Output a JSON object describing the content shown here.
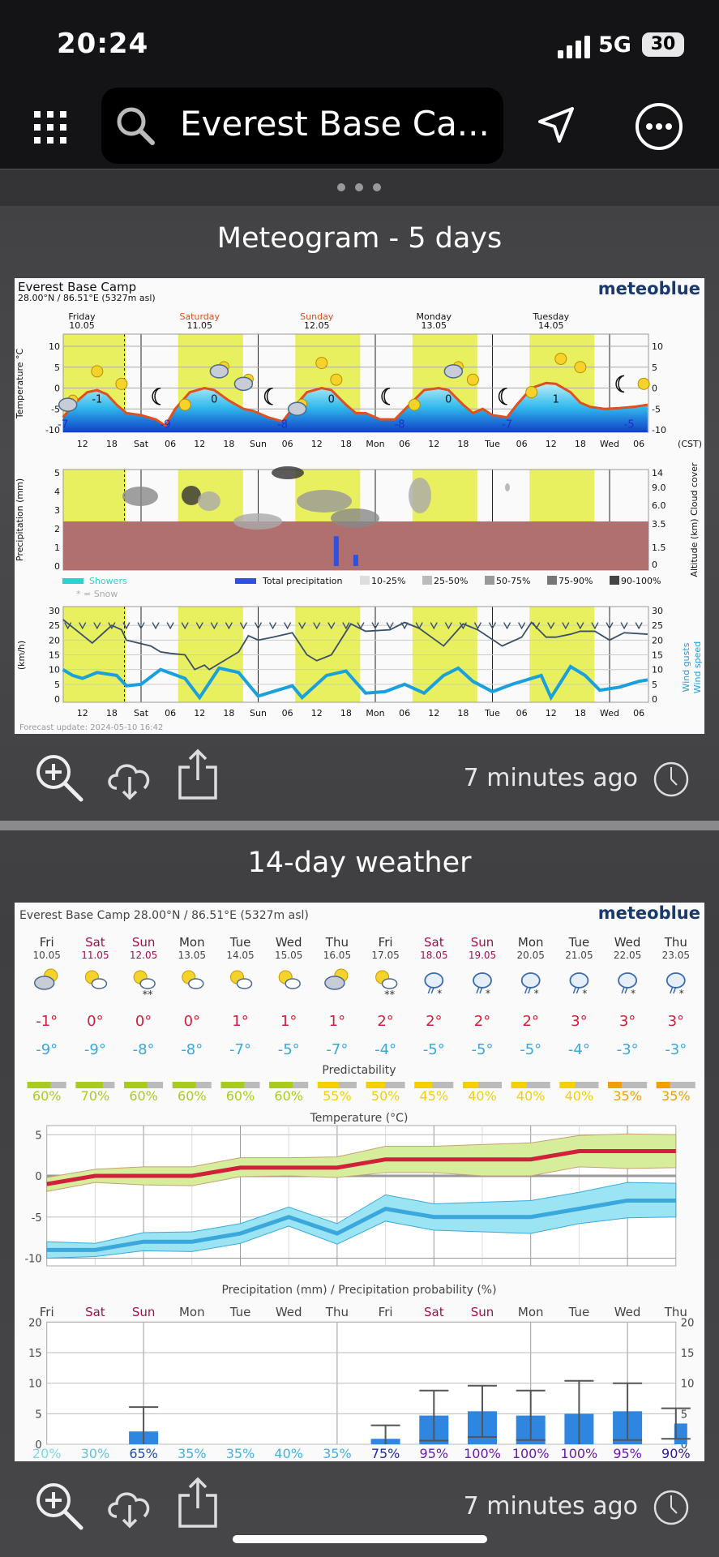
{
  "status_bar": {
    "time": "20:24",
    "network": "5G",
    "battery": "30"
  },
  "search": {
    "value": "Everest Base Ca..."
  },
  "icons": {
    "menu": "grid-icon",
    "search": "search-icon",
    "location": "location-arrow-icon",
    "more": "more-icon"
  },
  "meteogram": {
    "section_title": "Meteogram - 5 days",
    "location": "Everest Base Camp",
    "coords": "28.00°N / 86.51°E (5327m asl)",
    "brand": "meteoblue",
    "brand_color": "#1a3a6b",
    "days": [
      {
        "name": "Friday",
        "date": "10.05",
        "weekend": false
      },
      {
        "name": "Saturday",
        "date": "11.05",
        "weekend": true
      },
      {
        "name": "Sunday",
        "date": "12.05",
        "weekend": true
      },
      {
        "name": "Monday",
        "date": "13.05",
        "weekend": false
      },
      {
        "name": "Tuesday",
        "date": "14.05",
        "weekend": false
      }
    ],
    "x_ticks": [
      "12",
      "18",
      "Sat",
      "06",
      "12",
      "18",
      "Sun",
      "06",
      "12",
      "18",
      "Mon",
      "06",
      "12",
      "18",
      "Tue",
      "06",
      "12",
      "18",
      "Wed",
      "06"
    ],
    "timezone": "(CST)",
    "temp_axis_label": "Temperature °C",
    "temp_ticks": [
      10,
      5,
      0,
      -5,
      -10
    ],
    "temperature": [
      [
        8,
        -7
      ],
      [
        11,
        -3
      ],
      [
        13,
        -1
      ],
      [
        15,
        -0.5
      ],
      [
        17,
        -1.5
      ],
      [
        19,
        -4
      ],
      [
        21,
        -6
      ],
      [
        24,
        -6.5
      ],
      [
        27,
        -7.5
      ],
      [
        29,
        -9
      ],
      [
        31,
        -5
      ],
      [
        34,
        -1
      ],
      [
        37,
        0
      ],
      [
        39,
        -0.5
      ],
      [
        42,
        -3
      ],
      [
        45,
        -5
      ],
      [
        47,
        -5.5
      ],
      [
        50,
        -7
      ],
      [
        53,
        -8
      ],
      [
        55,
        -5
      ],
      [
        58,
        -1
      ],
      [
        61,
        0
      ],
      [
        63,
        -0.5
      ],
      [
        66,
        -4
      ],
      [
        68,
        -6
      ],
      [
        70,
        -6
      ],
      [
        73,
        -7.5
      ],
      [
        76,
        -7.5
      ],
      [
        79,
        -4
      ],
      [
        82,
        -0.5
      ],
      [
        85,
        0
      ],
      [
        87,
        -0.5
      ],
      [
        90,
        -4
      ],
      [
        92,
        -6
      ],
      [
        94,
        -5
      ],
      [
        96,
        -6.5
      ],
      [
        99,
        -7
      ],
      [
        101,
        -4
      ],
      [
        104,
        0
      ],
      [
        107,
        1.2
      ],
      [
        109,
        1
      ],
      [
        112,
        -1
      ],
      [
        114,
        -3.5
      ],
      [
        116,
        -4.5
      ],
      [
        119,
        -5
      ],
      [
        122,
        -4.8
      ],
      [
        125,
        -4.5
      ],
      [
        127.8,
        -4
      ]
    ],
    "max_labels": [
      "-1",
      "0",
      "0",
      "0",
      "1"
    ],
    "min_labels": [
      "-7",
      "-9",
      "-8",
      "-8",
      "-7",
      "-5"
    ],
    "precip_axis_label": "Precipitation (mm)",
    "precip_ticks": [
      5,
      4,
      3,
      2,
      1,
      0
    ],
    "altitude_ticks": [
      "14",
      "9.0",
      "6.0",
      "3.5",
      "1.5",
      "0"
    ],
    "right_axis_label": "Altitude (km) Cloud cover",
    "precipitation": [
      [
        64,
        1.6
      ],
      [
        68,
        0.6
      ]
    ],
    "legend": {
      "showers": "Showers",
      "snow": "* = Snow",
      "total": "Total precipitation",
      "cover": [
        "10-25%",
        "25-50%",
        "50-75%",
        "75-90%",
        "90-100%"
      ]
    },
    "wind_axis_label": "(km/h)",
    "wind_ticks": [
      30,
      25,
      20,
      15,
      10,
      5,
      0
    ],
    "wind_gusts_label": "Wind gusts",
    "wind_speed_label": "Wind speed",
    "wind_gusts": [
      [
        8,
        27
      ],
      [
        14,
        19
      ],
      [
        18,
        25
      ],
      [
        20,
        23.5
      ],
      [
        21,
        20
      ],
      [
        26,
        18
      ],
      [
        28,
        16
      ],
      [
        30,
        15.5
      ],
      [
        33,
        15
      ],
      [
        35,
        10
      ],
      [
        37,
        11.5
      ],
      [
        38,
        10
      ],
      [
        40,
        12
      ],
      [
        44,
        16
      ],
      [
        46,
        21.5
      ],
      [
        48,
        20
      ],
      [
        51,
        21
      ],
      [
        55,
        22.5
      ],
      [
        58,
        15
      ],
      [
        60,
        13
      ],
      [
        63,
        15
      ],
      [
        67,
        25.5
      ],
      [
        70,
        23
      ],
      [
        75,
        23.5
      ],
      [
        78,
        26
      ],
      [
        81,
        24
      ],
      [
        86,
        18
      ],
      [
        90,
        25.5
      ],
      [
        93,
        23.5
      ],
      [
        98,
        18
      ],
      [
        102,
        21
      ],
      [
        104,
        26
      ],
      [
        107,
        21
      ],
      [
        109,
        21
      ],
      [
        112,
        22
      ],
      [
        114,
        23
      ],
      [
        117,
        23
      ],
      [
        120,
        20
      ],
      [
        123,
        22.5
      ],
      [
        127.8,
        22
      ]
    ],
    "wind_speed": [
      [
        8,
        10
      ],
      [
        10,
        8
      ],
      [
        12,
        7
      ],
      [
        15,
        9
      ],
      [
        19,
        8
      ],
      [
        21,
        4.5
      ],
      [
        24,
        5
      ],
      [
        28,
        10
      ],
      [
        33,
        7
      ],
      [
        36,
        0.5
      ],
      [
        40,
        10.5
      ],
      [
        44,
        9
      ],
      [
        48,
        1
      ],
      [
        52,
        3
      ],
      [
        55,
        4.5
      ],
      [
        57,
        0.5
      ],
      [
        62,
        8
      ],
      [
        66,
        9.5
      ],
      [
        70,
        2
      ],
      [
        74,
        2.5
      ],
      [
        78,
        5
      ],
      [
        82,
        2
      ],
      [
        86,
        8
      ],
      [
        89,
        10.5
      ],
      [
        92,
        6
      ],
      [
        96,
        2.5
      ],
      [
        100,
        5
      ],
      [
        104,
        7
      ],
      [
        106,
        8
      ],
      [
        108,
        0.5
      ],
      [
        112,
        11
      ],
      [
        115,
        8
      ],
      [
        118,
        3
      ],
      [
        122,
        4
      ],
      [
        126,
        6
      ],
      [
        127.8,
        6.5
      ]
    ],
    "forecast_update": "Forecast update: 2024-05-10 16:42",
    "updated_ago": "7 minutes ago"
  },
  "fourteen_day": {
    "section_title": "14-day weather",
    "header": "Everest Base Camp  28.00°N / 86.51°E (5327m asl)",
    "brand": "meteoblue",
    "days": [
      {
        "name": "Fri",
        "date": "10.05",
        "weekend": false,
        "icon": "cloudy-sun",
        "max": "-1°",
        "min": "-9°",
        "pred": 60,
        "precip": 0,
        "precip_hi": 0,
        "precip_lo": 0,
        "prob": "20%"
      },
      {
        "name": "Sat",
        "date": "11.05",
        "weekend": true,
        "icon": "sun-cloud",
        "max": "0°",
        "min": "-9°",
        "pred": 70,
        "precip": 0,
        "precip_hi": 0,
        "precip_lo": 0,
        "prob": "30%"
      },
      {
        "name": "Sun",
        "date": "12.05",
        "weekend": true,
        "icon": "sun-cloud-snow",
        "max": "0°",
        "min": "-8°",
        "pred": 60,
        "precip": 2.1,
        "precip_hi": 6.1,
        "precip_lo": 0,
        "prob": "65%"
      },
      {
        "name": "Mon",
        "date": "13.05",
        "weekend": false,
        "icon": "sun-cloud",
        "max": "0°",
        "min": "-8°",
        "pred": 60,
        "precip": 0,
        "precip_hi": 0,
        "precip_lo": 0,
        "prob": "35%"
      },
      {
        "name": "Tue",
        "date": "14.05",
        "weekend": false,
        "icon": "sun-cloud",
        "max": "1°",
        "min": "-7°",
        "pred": 60,
        "precip": 0,
        "precip_hi": 0,
        "precip_lo": 0,
        "prob": "35%"
      },
      {
        "name": "Wed",
        "date": "15.05",
        "weekend": false,
        "icon": "sun-cloud",
        "max": "1°",
        "min": "-5°",
        "pred": 60,
        "precip": 0,
        "precip_hi": 0,
        "precip_lo": 0,
        "prob": "40%"
      },
      {
        "name": "Thu",
        "date": "16.05",
        "weekend": false,
        "icon": "cloudy-sun",
        "max": "1°",
        "min": "-7°",
        "pred": 55,
        "precip": 0,
        "precip_hi": 0,
        "precip_lo": 0,
        "prob": "35%"
      },
      {
        "name": "Fri",
        "date": "17.05",
        "weekend": false,
        "icon": "sun-cloud-snow",
        "max": "2°",
        "min": "-4°",
        "pred": 50,
        "precip": 0.9,
        "precip_hi": 3.1,
        "precip_lo": 0,
        "prob": "75%"
      },
      {
        "name": "Sat",
        "date": "18.05",
        "weekend": true,
        "icon": "storm-snow",
        "max": "2°",
        "min": "-5°",
        "pred": 45,
        "precip": 4.7,
        "precip_hi": 8.8,
        "precip_lo": 0.6,
        "prob": "95%"
      },
      {
        "name": "Sun",
        "date": "19.05",
        "weekend": true,
        "icon": "storm-snow",
        "max": "2°",
        "min": "-5°",
        "pred": 40,
        "precip": 5.4,
        "precip_hi": 9.6,
        "precip_lo": 1.2,
        "prob": "100%"
      },
      {
        "name": "Mon",
        "date": "20.05",
        "weekend": false,
        "icon": "storm-snow",
        "max": "2°",
        "min": "-5°",
        "pred": 40,
        "precip": 4.7,
        "precip_hi": 8.8,
        "precip_lo": 0.7,
        "prob": "100%"
      },
      {
        "name": "Tue",
        "date": "21.05",
        "weekend": false,
        "icon": "storm-snow",
        "max": "3°",
        "min": "-4°",
        "pred": 40,
        "precip": 5.0,
        "precip_hi": 10.4,
        "precip_lo": 0,
        "prob": "100%"
      },
      {
        "name": "Wed",
        "date": "22.05",
        "weekend": false,
        "icon": "storm-snow",
        "max": "3°",
        "min": "-3°",
        "pred": 35,
        "precip": 5.4,
        "precip_hi": 10.0,
        "precip_lo": 0.7,
        "prob": "95%"
      },
      {
        "name": "Thu",
        "date": "23.05",
        "weekend": false,
        "icon": "storm-snow",
        "max": "3°",
        "min": "-3°",
        "pred": 35,
        "precip": 3.4,
        "precip_hi": 5.9,
        "precip_lo": 0.9,
        "prob": "90%"
      }
    ],
    "prob_colors": [
      "#7dd7e8",
      "#5ec4e0",
      "#1e4fb4",
      "#47b0dc",
      "#47b0dc",
      "#47b0dc",
      "#47b0dc",
      "#1a2c9c",
      "#6a1ab0",
      "#6a1ab0",
      "#6a1ab0",
      "#6a1ab0",
      "#6a1ab0",
      "#2c1a9c"
    ],
    "predictability_label": "Predictability",
    "temp_title": "Temperature (°C)",
    "temp_ticks": [
      5,
      0,
      -5,
      -10
    ],
    "tmax_upper": [
      -0.2,
      0.8,
      1.1,
      1.1,
      2.2,
      2.2,
      2.3,
      3.6,
      3.6,
      3.8,
      4,
      4.9,
      5.1,
      5
    ],
    "tmax_lower": [
      -1.9,
      -0.8,
      -1.1,
      -1.2,
      -0.1,
      0,
      -0.2,
      0.4,
      0.4,
      0,
      0,
      1.1,
      0.9,
      1
    ],
    "tmax": [
      -1,
      0,
      0,
      0,
      1,
      1,
      1,
      2,
      2,
      2,
      2,
      3,
      3,
      3
    ],
    "tmin_upper": [
      -8,
      -8.2,
      -6.9,
      -6.8,
      -5.8,
      -3.8,
      -5.8,
      -2.3,
      -3.4,
      -3.2,
      -3,
      -2,
      -0.8,
      -0.9
    ],
    "tmin_lower": [
      -10,
      -9.8,
      -9.1,
      -9.2,
      -8.2,
      -6.1,
      -8.3,
      -5.5,
      -6.6,
      -6.8,
      -7,
      -5.8,
      -5.1,
      -5
    ],
    "tmin": [
      -9,
      -9,
      -8,
      -8,
      -7,
      -5,
      -7,
      -4,
      -5,
      -5,
      -5,
      -4,
      -3,
      -3
    ],
    "precip_title": "Precipitation (mm) / Precipitation probability (%)",
    "precip_ticks": [
      20,
      15,
      10,
      5,
      0
    ],
    "updated_ago": "7 minutes ago"
  },
  "colors": {
    "weekend": "#a0104a",
    "weekend_meteogram": "#d2501e",
    "day_band": "#e8f060",
    "max_temp": "#d0203a",
    "min_temp": "#3aa8dc",
    "precip_bar": "#2e86e0"
  }
}
